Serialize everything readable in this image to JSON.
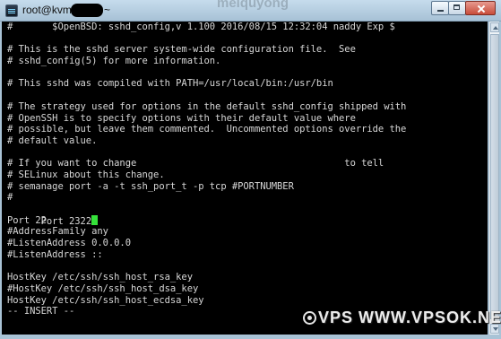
{
  "window": {
    "title_prefix": "root@kvm",
    "title_suffix": "~",
    "faint_overlay_text": "meiquyong"
  },
  "terminal": {
    "lines": [
      "#       $OpenBSD: sshd_config,v 1.100 2016/08/15 12:32:04 naddy Exp $",
      "",
      "# This is the sshd server system-wide configuration file.  See",
      "# sshd_config(5) for more information.",
      "",
      "# This sshd was compiled with PATH=/usr/local/bin:/usr/bin",
      "",
      "# The strategy used for options in the default sshd_config shipped with",
      "# OpenSSH is to specify options with their default value where",
      "# possible, but leave them commented.  Uncommented options override the",
      "# default value.",
      "",
      "# If you want to change                                     to tell",
      "# SELinux about this change.",
      "# semanage port -a -t ssh_port_t -p tcp #PORTNUMBER",
      "#",
      "Port 2322",
      "Port 22",
      "#AddressFamily any",
      "#ListenAddress 0.0.0.0",
      "#ListenAddress ::",
      "",
      "HostKey /etc/ssh/ssh_host_rsa_key",
      "#HostKey /etc/ssh/ssh_host_dsa_key",
      "HostKey /etc/ssh/ssh_host_ecdsa_key",
      "-- INSERT --"
    ]
  },
  "watermark": {
    "text": "VPS WWW.VPSOK.NET"
  },
  "icons": {
    "app": "terminal-icon",
    "minimize": "minimize-icon",
    "maximize": "maximize-icon",
    "close": "close-icon",
    "logo": "vps-logo-icon"
  },
  "colors": {
    "terminal_bg": "#000000",
    "terminal_fg": "#d7d7d7",
    "cursor": "#35e13a",
    "titlebar": "#b5cde0"
  }
}
